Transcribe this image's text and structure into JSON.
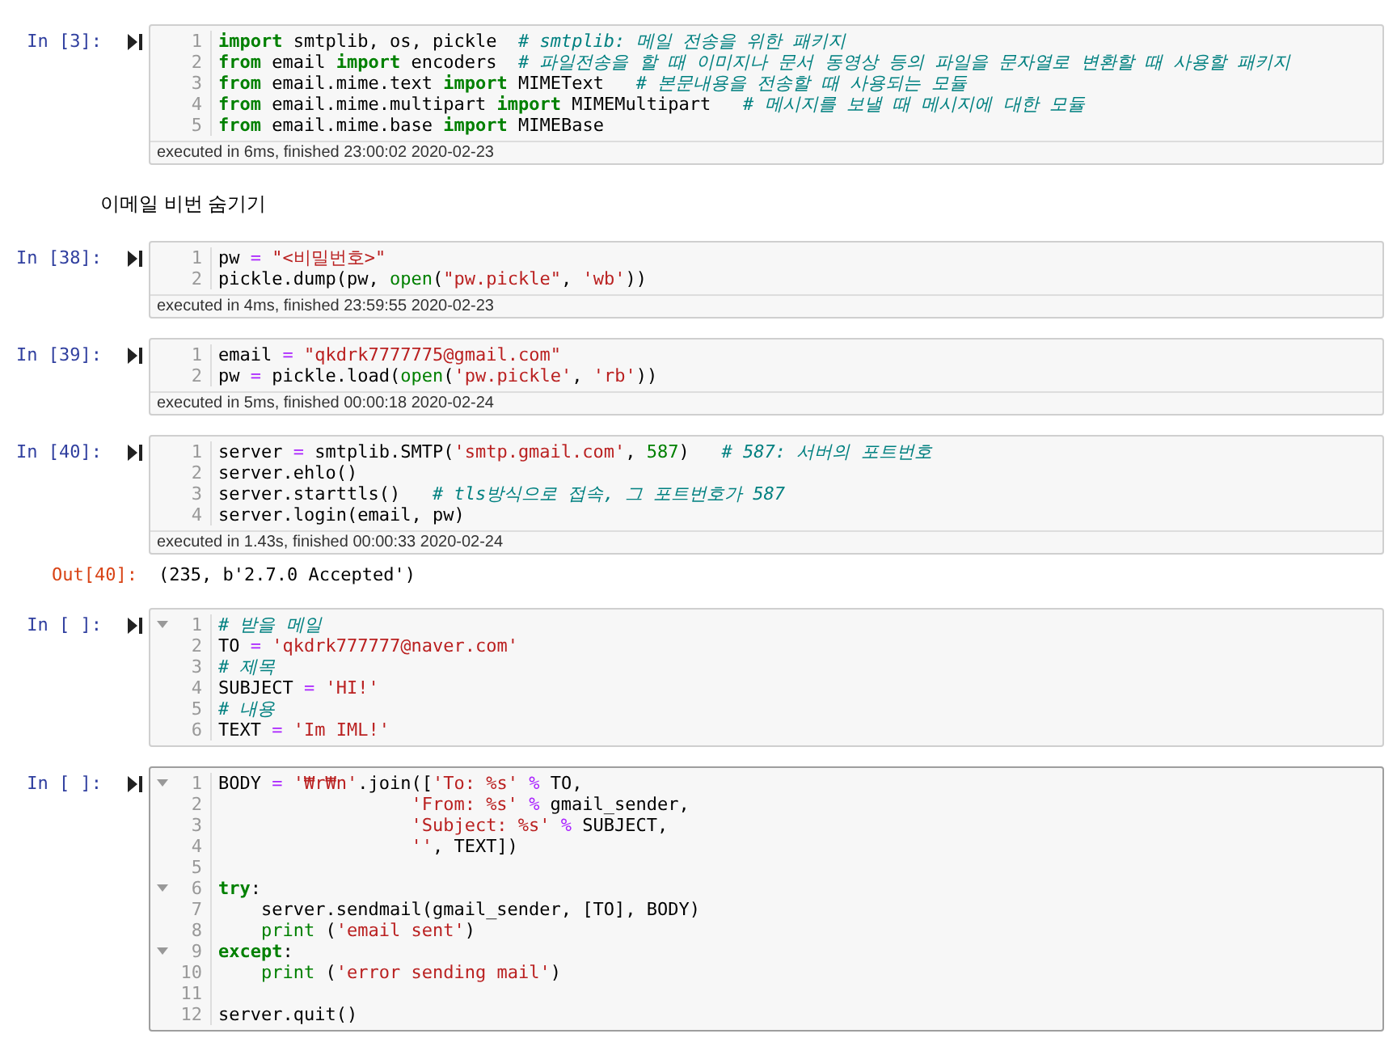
{
  "cells": [
    {
      "kind": "code",
      "prompt": "In [3]:",
      "selected": false,
      "footer": "executed in 6ms, finished 23:00:02 2020-02-23",
      "lines": [
        {
          "n": "1",
          "fold": false,
          "tokens": [
            {
              "t": "import",
              "kind": "kw"
            },
            {
              "t": " smtplib, os, pickle  ",
              "kind": "p"
            },
            {
              "t": "# smtplib: 메일 전송을 위한 패키지",
              "kind": "c"
            }
          ]
        },
        {
          "n": "2",
          "fold": false,
          "tokens": [
            {
              "t": "from",
              "kind": "kw"
            },
            {
              "t": " email ",
              "kind": "p"
            },
            {
              "t": "import",
              "kind": "kw"
            },
            {
              "t": " encoders  ",
              "kind": "p"
            },
            {
              "t": "# 파일전송을 할 때 이미지나 문서 동영상 등의 파일을 문자열로 변환할 때 사용할 패키지",
              "kind": "c"
            }
          ]
        },
        {
          "n": "3",
          "fold": false,
          "tokens": [
            {
              "t": "from",
              "kind": "kw"
            },
            {
              "t": " email.mime.text ",
              "kind": "p"
            },
            {
              "t": "import",
              "kind": "kw"
            },
            {
              "t": " MIMEText   ",
              "kind": "p"
            },
            {
              "t": "# 본문내용을 전송할 때 사용되는 모듈",
              "kind": "c"
            }
          ]
        },
        {
          "n": "4",
          "fold": false,
          "tokens": [
            {
              "t": "from",
              "kind": "kw"
            },
            {
              "t": " email.mime.multipart ",
              "kind": "p"
            },
            {
              "t": "import",
              "kind": "kw"
            },
            {
              "t": " MIMEMultipart   ",
              "kind": "p"
            },
            {
              "t": "# 메시지를 보낼 때 메시지에 대한 모듈",
              "kind": "c"
            }
          ]
        },
        {
          "n": "5",
          "fold": false,
          "tokens": [
            {
              "t": "from",
              "kind": "kw"
            },
            {
              "t": " email.mime.base ",
              "kind": "p"
            },
            {
              "t": "import",
              "kind": "kw"
            },
            {
              "t": " MIMEBase",
              "kind": "p"
            }
          ]
        }
      ]
    },
    {
      "kind": "markdown",
      "text": "이메일 비번 숨기기"
    },
    {
      "kind": "code",
      "prompt": "In [38]:",
      "selected": false,
      "footer": "executed in 4ms, finished 23:59:55 2020-02-23",
      "lines": [
        {
          "n": "1",
          "fold": false,
          "tokens": [
            {
              "t": "pw ",
              "kind": "p"
            },
            {
              "t": "=",
              "kind": "o"
            },
            {
              "t": " \"<비밀번호>\"",
              "kind": "s"
            }
          ]
        },
        {
          "n": "2",
          "fold": false,
          "tokens": [
            {
              "t": "pickle.dump(pw, ",
              "kind": "p"
            },
            {
              "t": "open",
              "kind": "b"
            },
            {
              "t": "(",
              "kind": "p"
            },
            {
              "t": "\"pw.pickle\"",
              "kind": "s"
            },
            {
              "t": ", ",
              "kind": "p"
            },
            {
              "t": "'wb'",
              "kind": "s"
            },
            {
              "t": "))",
              "kind": "p"
            }
          ]
        }
      ]
    },
    {
      "kind": "code",
      "prompt": "In [39]:",
      "selected": false,
      "footer": "executed in 5ms, finished 00:00:18 2020-02-24",
      "lines": [
        {
          "n": "1",
          "fold": false,
          "tokens": [
            {
              "t": "email ",
              "kind": "p"
            },
            {
              "t": "=",
              "kind": "o"
            },
            {
              "t": " \"qkdrk7777775@gmail.com\"",
              "kind": "s"
            }
          ]
        },
        {
          "n": "2",
          "fold": false,
          "tokens": [
            {
              "t": "pw ",
              "kind": "p"
            },
            {
              "t": "=",
              "kind": "o"
            },
            {
              "t": " pickle.load(",
              "kind": "p"
            },
            {
              "t": "open",
              "kind": "b"
            },
            {
              "t": "(",
              "kind": "p"
            },
            {
              "t": "'pw.pickle'",
              "kind": "s"
            },
            {
              "t": ", ",
              "kind": "p"
            },
            {
              "t": "'rb'",
              "kind": "s"
            },
            {
              "t": "))",
              "kind": "p"
            }
          ]
        }
      ]
    },
    {
      "kind": "code",
      "prompt": "In [40]:",
      "selected": false,
      "footer": "executed in 1.43s, finished 00:00:33 2020-02-24",
      "output": {
        "prompt": "Out[40]:",
        "text": "(235, b'2.7.0 Accepted')"
      },
      "lines": [
        {
          "n": "1",
          "fold": false,
          "tokens": [
            {
              "t": "server ",
              "kind": "p"
            },
            {
              "t": "=",
              "kind": "o"
            },
            {
              "t": " smtplib.SMTP(",
              "kind": "p"
            },
            {
              "t": "'smtp.gmail.com'",
              "kind": "s"
            },
            {
              "t": ", ",
              "kind": "p"
            },
            {
              "t": "587",
              "kind": "n"
            },
            {
              "t": ")   ",
              "kind": "p"
            },
            {
              "t": "# 587: 서버의 포트번호",
              "kind": "c"
            }
          ]
        },
        {
          "n": "2",
          "fold": false,
          "tokens": [
            {
              "t": "server.ehlo()",
              "kind": "p"
            }
          ]
        },
        {
          "n": "3",
          "fold": false,
          "tokens": [
            {
              "t": "server.starttls()   ",
              "kind": "p"
            },
            {
              "t": "# tls방식으로 접속, 그 포트번호가 587",
              "kind": "c"
            }
          ]
        },
        {
          "n": "4",
          "fold": false,
          "tokens": [
            {
              "t": "server.login(email, pw)",
              "kind": "p"
            }
          ]
        }
      ]
    },
    {
      "kind": "code",
      "prompt": "In [ ]:",
      "selected": false,
      "lines": [
        {
          "n": "1",
          "fold": true,
          "tokens": [
            {
              "t": "# 받을 메일",
              "kind": "c"
            }
          ]
        },
        {
          "n": "2",
          "fold": false,
          "tokens": [
            {
              "t": "TO ",
              "kind": "p"
            },
            {
              "t": "=",
              "kind": "o"
            },
            {
              "t": " 'qkdrk777777@naver.com'",
              "kind": "s"
            }
          ]
        },
        {
          "n": "3",
          "fold": false,
          "tokens": [
            {
              "t": "# 제목",
              "kind": "c"
            }
          ]
        },
        {
          "n": "4",
          "fold": false,
          "tokens": [
            {
              "t": "SUBJECT ",
              "kind": "p"
            },
            {
              "t": "=",
              "kind": "o"
            },
            {
              "t": " 'HI!'",
              "kind": "s"
            }
          ]
        },
        {
          "n": "5",
          "fold": false,
          "tokens": [
            {
              "t": "# 내용",
              "kind": "c"
            }
          ]
        },
        {
          "n": "6",
          "fold": false,
          "tokens": [
            {
              "t": "TEXT ",
              "kind": "p"
            },
            {
              "t": "=",
              "kind": "o"
            },
            {
              "t": " 'Im IML!'",
              "kind": "s"
            }
          ]
        }
      ]
    },
    {
      "kind": "code",
      "prompt": "In [ ]:",
      "selected": true,
      "lines": [
        {
          "n": "1",
          "fold": true,
          "tokens": [
            {
              "t": "BODY ",
              "kind": "p"
            },
            {
              "t": "=",
              "kind": "o"
            },
            {
              "t": " '₩r₩n'",
              "kind": "s"
            },
            {
              "t": ".join([",
              "kind": "p"
            },
            {
              "t": "'To: %s' ",
              "kind": "s"
            },
            {
              "t": "%",
              "kind": "o"
            },
            {
              "t": " TO,",
              "kind": "p"
            }
          ]
        },
        {
          "n": "2",
          "fold": false,
          "tokens": [
            {
              "t": "                  'From: %s' ",
              "kind": "s"
            },
            {
              "t": "%",
              "kind": "o"
            },
            {
              "t": " gmail_sender,",
              "kind": "p"
            }
          ]
        },
        {
          "n": "3",
          "fold": false,
          "tokens": [
            {
              "t": "                  'Subject: %s' ",
              "kind": "s"
            },
            {
              "t": "%",
              "kind": "o"
            },
            {
              "t": " SUBJECT,",
              "kind": "p"
            }
          ]
        },
        {
          "n": "4",
          "fold": false,
          "tokens": [
            {
              "t": "                  ''",
              "kind": "s"
            },
            {
              "t": ", TEXT])",
              "kind": "p"
            }
          ]
        },
        {
          "n": "5",
          "fold": false
        },
        {
          "n": "6",
          "fold": true,
          "tokens": [
            {
              "t": "try",
              "kind": "kw"
            },
            {
              "t": ":",
              "kind": "p"
            }
          ]
        },
        {
          "n": "7",
          "fold": false,
          "tokens": [
            {
              "t": "    server.sendmail(gmail_sender, [TO], BODY)",
              "kind": "p"
            }
          ]
        },
        {
          "n": "8",
          "fold": false,
          "tokens": [
            {
              "t": "    print",
              "kind": "b"
            },
            {
              "t": " (",
              "kind": "p"
            },
            {
              "t": "'email sent'",
              "kind": "s"
            },
            {
              "t": ")",
              "kind": "p"
            }
          ]
        },
        {
          "n": "9",
          "fold": true,
          "tokens": [
            {
              "t": "except",
              "kind": "kw"
            },
            {
              "t": ":",
              "kind": "p"
            }
          ]
        },
        {
          "n": "10",
          "fold": false,
          "tokens": [
            {
              "t": "    print",
              "kind": "b"
            },
            {
              "t": " (",
              "kind": "p"
            },
            {
              "t": "'error sending mail'",
              "kind": "s"
            },
            {
              "t": ")",
              "kind": "p"
            }
          ]
        },
        {
          "n": "11",
          "fold": false
        },
        {
          "n": "12",
          "fold": false,
          "tokens": [
            {
              "t": "server.quit()",
              "kind": "p"
            }
          ]
        }
      ]
    }
  ]
}
